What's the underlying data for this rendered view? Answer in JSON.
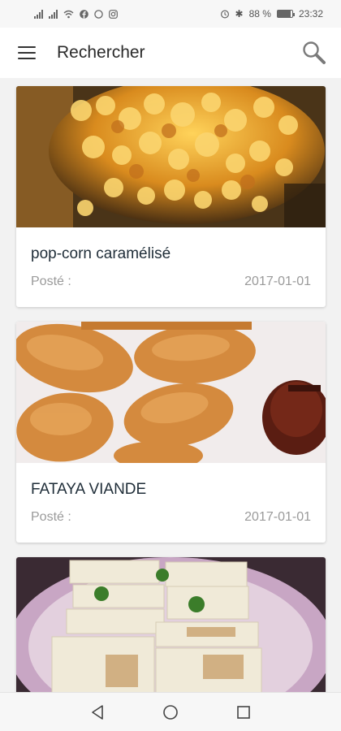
{
  "status_bar": {
    "battery_percent": "88 %",
    "time": "23:32",
    "battery_level": 0.88,
    "left_icons": [
      "signal-icon",
      "signal-icon",
      "wifi-icon",
      "facebook-icon",
      "circle-icon",
      "instagram-icon"
    ],
    "right_icons": [
      "alarm-icon",
      "bluetooth-icon"
    ]
  },
  "app_bar": {
    "title": "Rechercher",
    "icons": [
      "menu-icon",
      "search-icon"
    ]
  },
  "posts": [
    {
      "title": "pop-corn caramélisé",
      "posted_label": "Posté :",
      "date": "2017-01-01",
      "image": "caramel-popcorn-photo"
    },
    {
      "title": "FATAYA VIANDE",
      "posted_label": "Posté :",
      "date": "2017-01-01",
      "image": "fataya-pastries-photo"
    },
    {
      "title": "",
      "posted_label": "",
      "date": "",
      "image": "folded-crepes-photo"
    }
  ],
  "nav_bar": {
    "icons": [
      "back-icon",
      "home-icon",
      "recents-icon"
    ]
  },
  "colors": {
    "app_bar_bg": "#ffffff",
    "page_bg": "#f2f2f2",
    "title_text": "#1f2d38",
    "meta_text": "#9a9a9a"
  }
}
